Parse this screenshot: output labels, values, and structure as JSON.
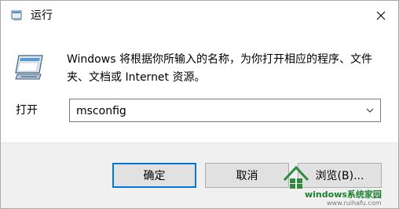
{
  "window": {
    "title": "运行",
    "title_icon": "run-icon",
    "close_icon": "close-icon"
  },
  "content": {
    "description": "Windows 将根据你所输入的名称，为你打开相应的程序、文件夹、文档或 Internet 资源。",
    "open_label": "打开",
    "input_value": "msconfig"
  },
  "buttons": {
    "ok": "确定",
    "cancel": "取消",
    "browse": "浏览(B)..."
  },
  "watermark": {
    "brand": "windows系统家园",
    "url": "www.ruihafu.com"
  },
  "colors": {
    "focus_border": "#0078d7",
    "footer_bg": "#f0f0f0",
    "button_bg": "#e1e1e1",
    "watermark_green": "#1a7f2e"
  }
}
